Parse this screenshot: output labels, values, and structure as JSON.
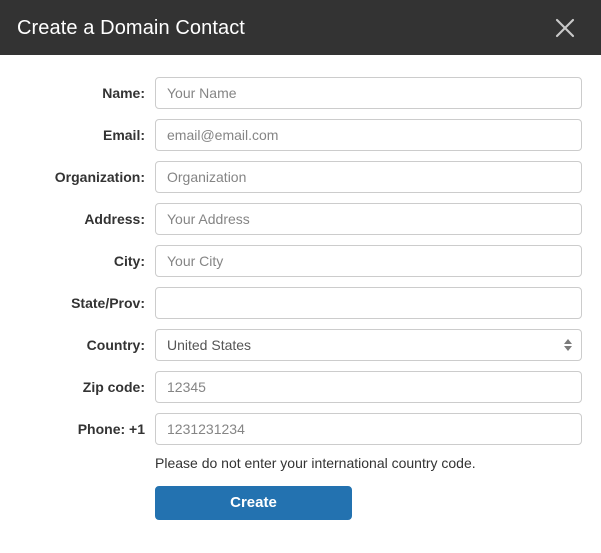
{
  "header": {
    "title": "Create a Domain Contact",
    "close_icon": "close-icon",
    "background_color": "#333333",
    "title_color": "#ffffff"
  },
  "form": {
    "fields": [
      {
        "label": "Name:",
        "name": "name",
        "type": "text",
        "value": "",
        "placeholder": "Your Name"
      },
      {
        "label": "Email:",
        "name": "email",
        "type": "text",
        "value": "",
        "placeholder": "email@email.com"
      },
      {
        "label": "Organization:",
        "name": "organization",
        "type": "text",
        "value": "",
        "placeholder": "Organization"
      },
      {
        "label": "Address:",
        "name": "address",
        "type": "text",
        "value": "",
        "placeholder": "Your Address"
      },
      {
        "label": "City:",
        "name": "city",
        "type": "text",
        "value": "",
        "placeholder": "Your City"
      },
      {
        "label": "State/Prov:",
        "name": "state",
        "type": "text",
        "value": "",
        "placeholder": ""
      },
      {
        "label": "Country:",
        "name": "country",
        "type": "select",
        "value": "United States",
        "placeholder": ""
      },
      {
        "label": "Zip code:",
        "name": "zipcode",
        "type": "text",
        "value": "",
        "placeholder": "12345"
      },
      {
        "label": "Phone: +1",
        "name": "phone",
        "type": "text",
        "value": "",
        "placeholder": "1231231234"
      }
    ],
    "country_options": [
      "United States"
    ],
    "country_selected": "United States",
    "help_text": "Please do not enter your international country code.",
    "submit_label": "Create",
    "submit_color": "#2372b0"
  }
}
